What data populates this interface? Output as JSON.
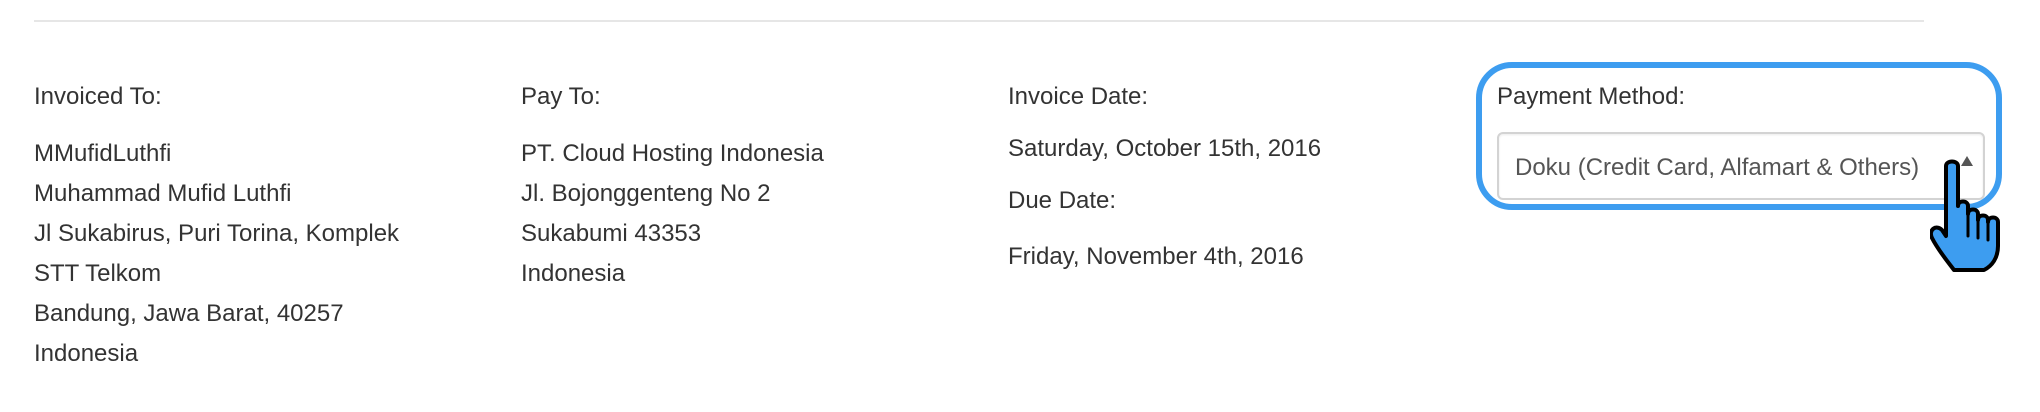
{
  "invoiced_to": {
    "label": "Invoiced To:",
    "lines": [
      "MMufidLuthfi",
      "Muhammad Mufid Luthfi",
      "Jl Sukabirus, Puri Torina, Komplek",
      "STT Telkom",
      "Bandung, Jawa Barat, 40257",
      "Indonesia"
    ]
  },
  "pay_to": {
    "label": "Pay To:",
    "lines": [
      "PT. Cloud Hosting Indonesia",
      "Jl. Bojonggenteng No 2",
      "Sukabumi 43353",
      "Indonesia"
    ]
  },
  "dates": {
    "invoice_label": "Invoice Date:",
    "invoice_value": "Saturday, October 15th, 2016",
    "due_label": "Due Date:",
    "due_value": "Friday, November 4th, 2016"
  },
  "payment": {
    "label": "Payment Method:",
    "selected": "Doku (Credit Card, Alfamart & Others)"
  },
  "colors": {
    "highlight": "#3d9df0",
    "cursor_fill": "#3d9df0",
    "text": "#333333",
    "divider": "#e6e6e6"
  },
  "icons": {
    "cursor": "pointing-hand-cursor-icon",
    "select_arrow": "caret-up-icon"
  }
}
